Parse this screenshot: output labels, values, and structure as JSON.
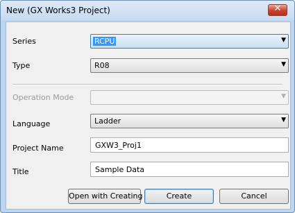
{
  "window": {
    "title": "New (GX Works3 Project)",
    "close_glyph": "✕"
  },
  "fields": {
    "series": {
      "label": "Series",
      "value": "RCPU"
    },
    "type": {
      "label": "Type",
      "value": "R08"
    },
    "operation_mode": {
      "label": "Operation Mode",
      "value": ""
    },
    "language": {
      "label": "Language",
      "value": "Ladder"
    },
    "project_name": {
      "label": "Project Name",
      "value": "GXW3_Proj1"
    },
    "title": {
      "label": "Title",
      "value": "Sample Data"
    }
  },
  "buttons": {
    "open_with_creating": "Open with Creating",
    "create": "Create",
    "cancel": "Cancel"
  },
  "icons": {
    "dropdown": "chevron-down-icon",
    "close": "close-icon"
  },
  "colors": {
    "title_bar": "#c6daf0",
    "close_button": "#c7412d",
    "selection": "#3399ff"
  }
}
